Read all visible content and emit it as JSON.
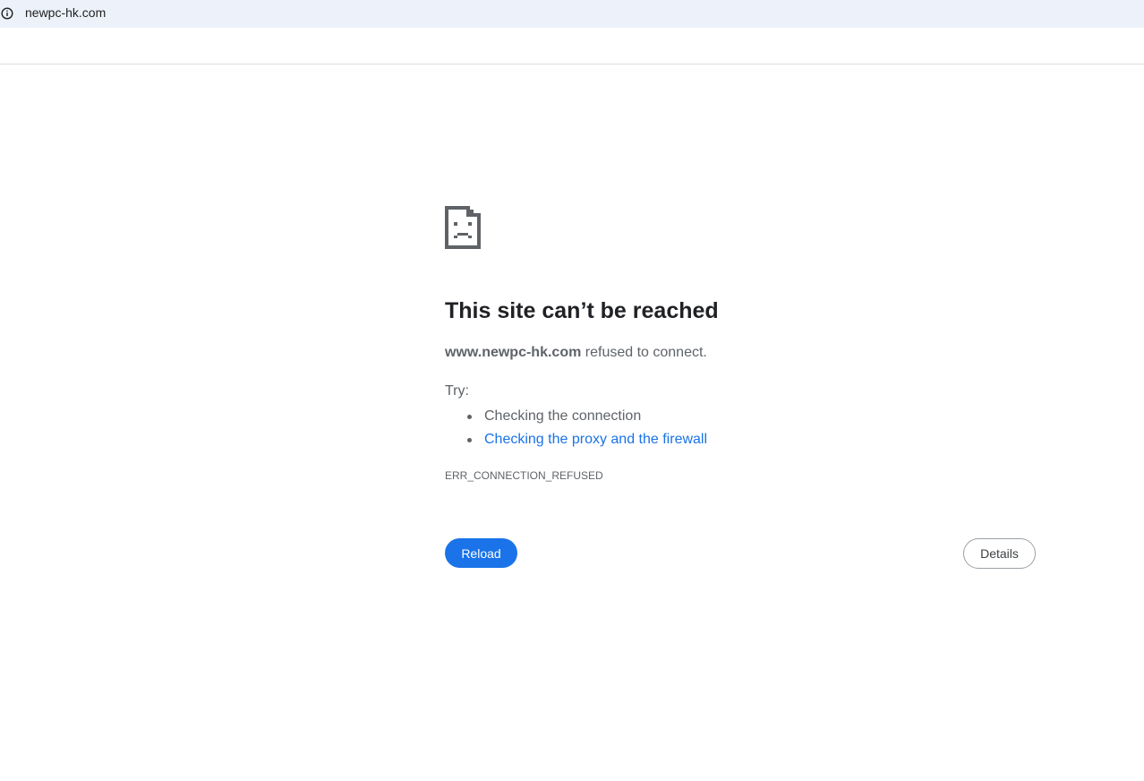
{
  "browser": {
    "url": "newpc-hk.com",
    "site_info_icon": "info-circle-icon"
  },
  "error_page": {
    "icon": "sad-page-icon",
    "heading": "This site can’t be reached",
    "host": "www.newpc-hk.com",
    "summary_suffix": " refused to connect.",
    "try_label": "Try:",
    "suggestions": [
      {
        "label": "Checking the connection",
        "is_link": false
      },
      {
        "label": "Checking the proxy and the firewall",
        "is_link": true
      }
    ],
    "error_code": "ERR_CONNECTION_REFUSED",
    "reload_label": "Reload",
    "details_label": "Details"
  },
  "colors": {
    "link": "#1a73e8",
    "primary_button": "#1a73e8",
    "urlbar_bg": "#edf2fa",
    "text": "#5f6368",
    "heading": "#202124"
  }
}
